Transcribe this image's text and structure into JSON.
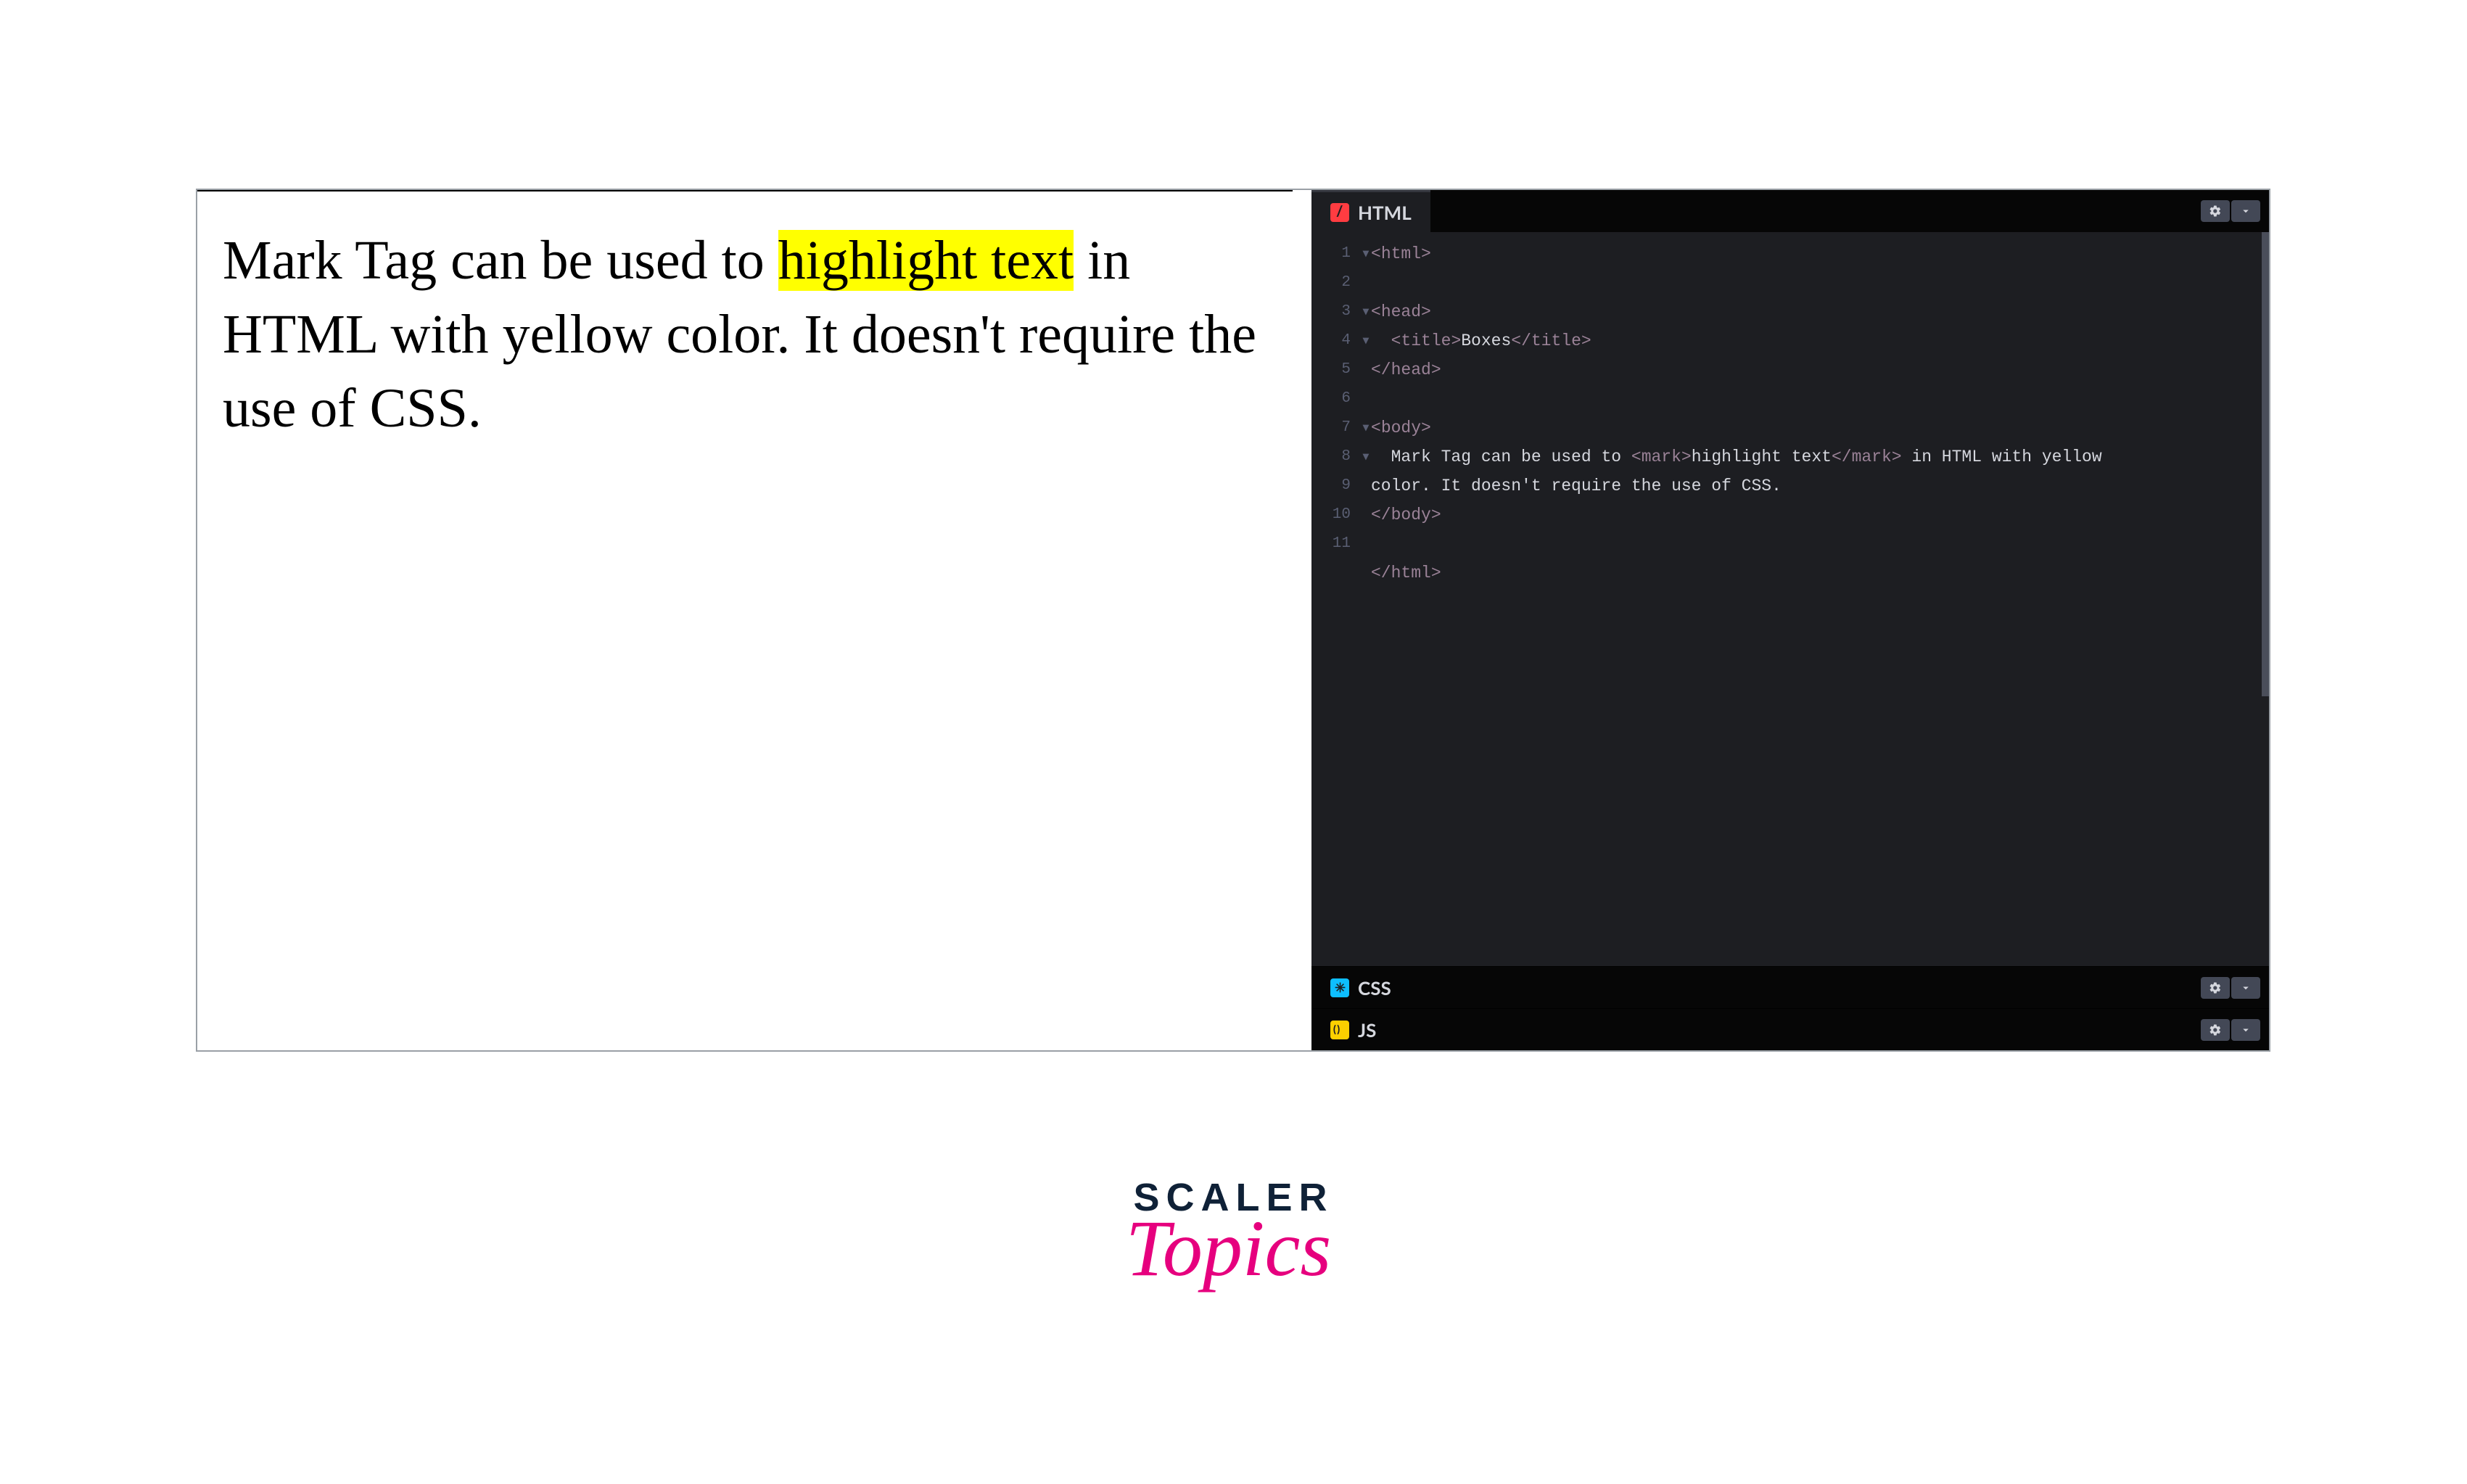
{
  "preview": {
    "text_before": "Mark Tag can be used to ",
    "highlight": "highlight text",
    "text_after": " in HTML with yellow color. It doesn't require the use of CSS."
  },
  "panels": {
    "html_label": "HTML",
    "css_label": "CSS",
    "js_label": "JS"
  },
  "code": {
    "line_numbers": [
      "1",
      "2",
      "3",
      "4",
      "5",
      "6",
      "7",
      "8",
      "",
      "9",
      "10",
      "11"
    ],
    "line1_open": "<",
    "line1_tag": "html",
    "line1_close": ">",
    "line3_open": "<",
    "line3_tag": "head",
    "line3_close": ">",
    "line4_open": "  <",
    "line4_tag": "title",
    "line4_mid": ">",
    "line4_text": "Boxes",
    "line4_endopen": "</",
    "line4_endtag": "title",
    "line4_endclose": ">",
    "line5_open": "</",
    "line5_tag": "head",
    "line5_close": ">",
    "line7_open": "<",
    "line7_tag": "body",
    "line7_close": ">",
    "line8_indent": "  ",
    "line8_t1": "Mark Tag can be used to ",
    "line8_mopen": "<",
    "line8_mtag": "mark",
    "line8_mclose": ">",
    "line8_t2": "highlight text",
    "line8_meopen": "</",
    "line8_metag": "mark",
    "line8_meclose": ">",
    "line8_t3": " in HTML with yellow ",
    "line8b_t": "color. It doesn't require the use of CSS.",
    "line9_open": "</",
    "line9_tag": "body",
    "line9_close": ">",
    "line11_open": "</",
    "line11_tag": "html",
    "line11_close": ">"
  },
  "logo": {
    "line1": "SCALER",
    "line2": "Topics"
  }
}
